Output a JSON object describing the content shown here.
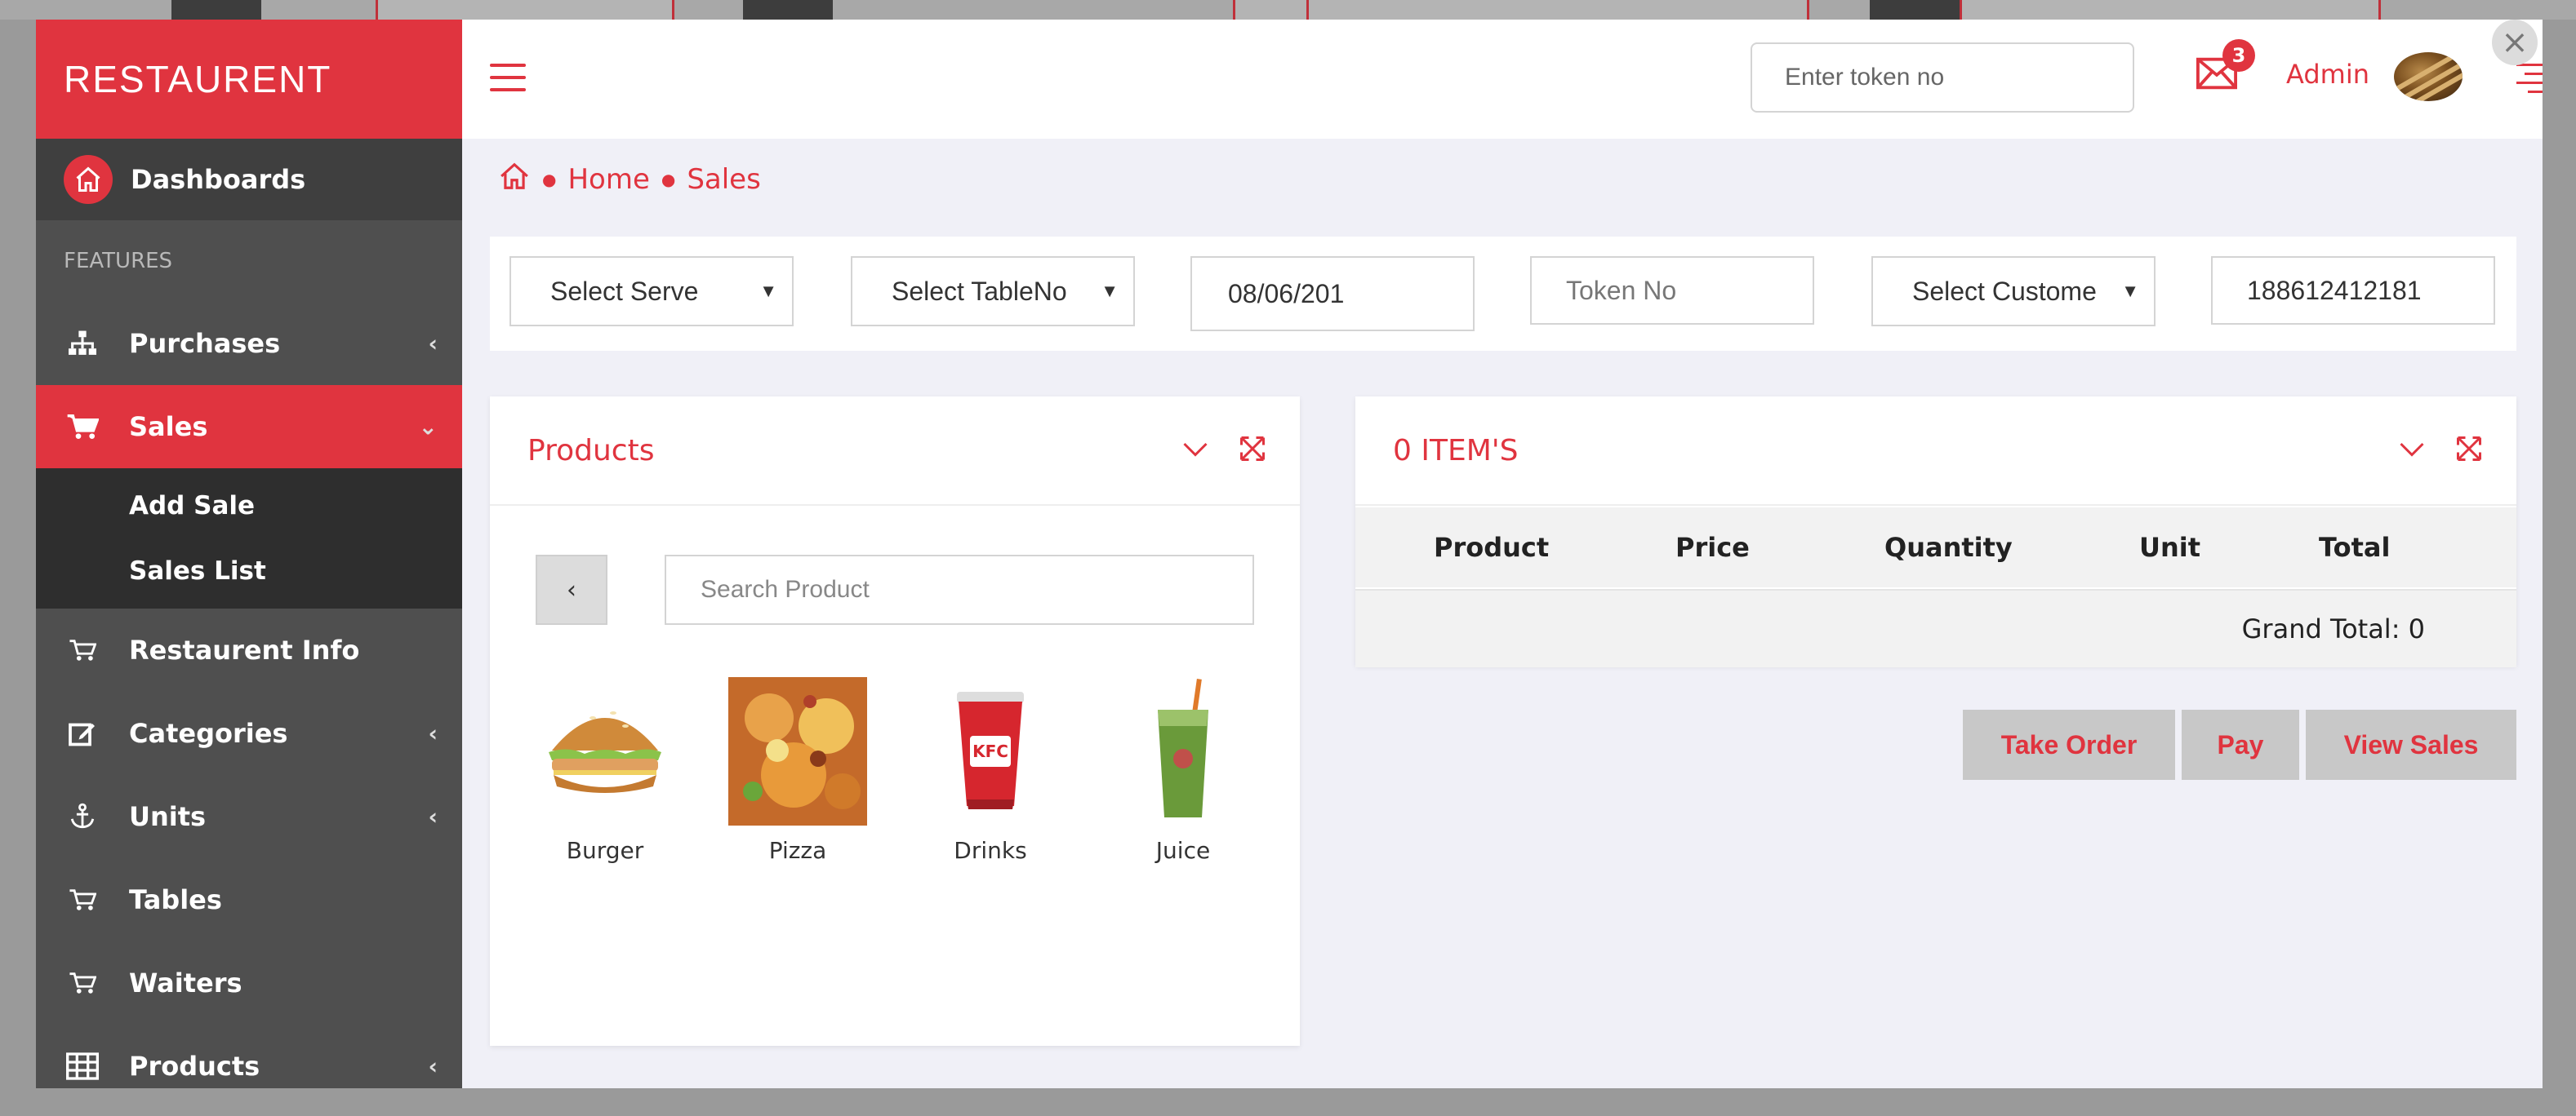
{
  "brand": {
    "name": "RESTAURENT"
  },
  "sidebar": {
    "dashboard": "Dashboards",
    "features_header": "FEATURES",
    "items": [
      {
        "label": "Purchases",
        "icon": "sitemap-icon",
        "has_children": true
      },
      {
        "label": "Sales",
        "icon": "cart-icon",
        "active": true,
        "expanded": true
      },
      {
        "label": "Restaurent Info",
        "icon": "cart-icon"
      },
      {
        "label": "Categories",
        "icon": "edit-icon",
        "has_children": true
      },
      {
        "label": "Units",
        "icon": "anchor-icon",
        "has_children": true
      },
      {
        "label": "Tables",
        "icon": "cart-icon"
      },
      {
        "label": "Waiters",
        "icon": "cart-icon"
      },
      {
        "label": "Products",
        "icon": "table-icon",
        "has_children": true
      }
    ],
    "sales_submenu": [
      "Add Sale",
      "Sales List"
    ]
  },
  "topbar": {
    "token_placeholder": "Enter token no",
    "mail_badge": "3",
    "admin_label": "Admin"
  },
  "breadcrumb": {
    "home": "Home",
    "current": "Sales"
  },
  "filters": {
    "server": "Select Serve",
    "table": "Select TableNo",
    "date": "08/06/201",
    "token_placeholder": "Token No",
    "customer": "Select Custome",
    "number": "188612412181"
  },
  "products_panel": {
    "title": "Products",
    "back_label": "‹",
    "search_placeholder": "Search Product",
    "items": [
      {
        "name": "Burger"
      },
      {
        "name": "Pizza"
      },
      {
        "name": "Drinks"
      },
      {
        "name": "Juice"
      }
    ]
  },
  "order_panel": {
    "title": "0 ITEM'S",
    "columns": [
      "Product",
      "Price",
      "Quantity",
      "Unit",
      "Total"
    ],
    "grand_total": "Grand Total: 0"
  },
  "actions": {
    "take_order": "Take Order",
    "pay": "Pay",
    "view_sales": "View Sales"
  },
  "colors": {
    "accent": "#e0343f",
    "sidebar": "#4f4f4f",
    "submenu": "#2e2e2e"
  }
}
